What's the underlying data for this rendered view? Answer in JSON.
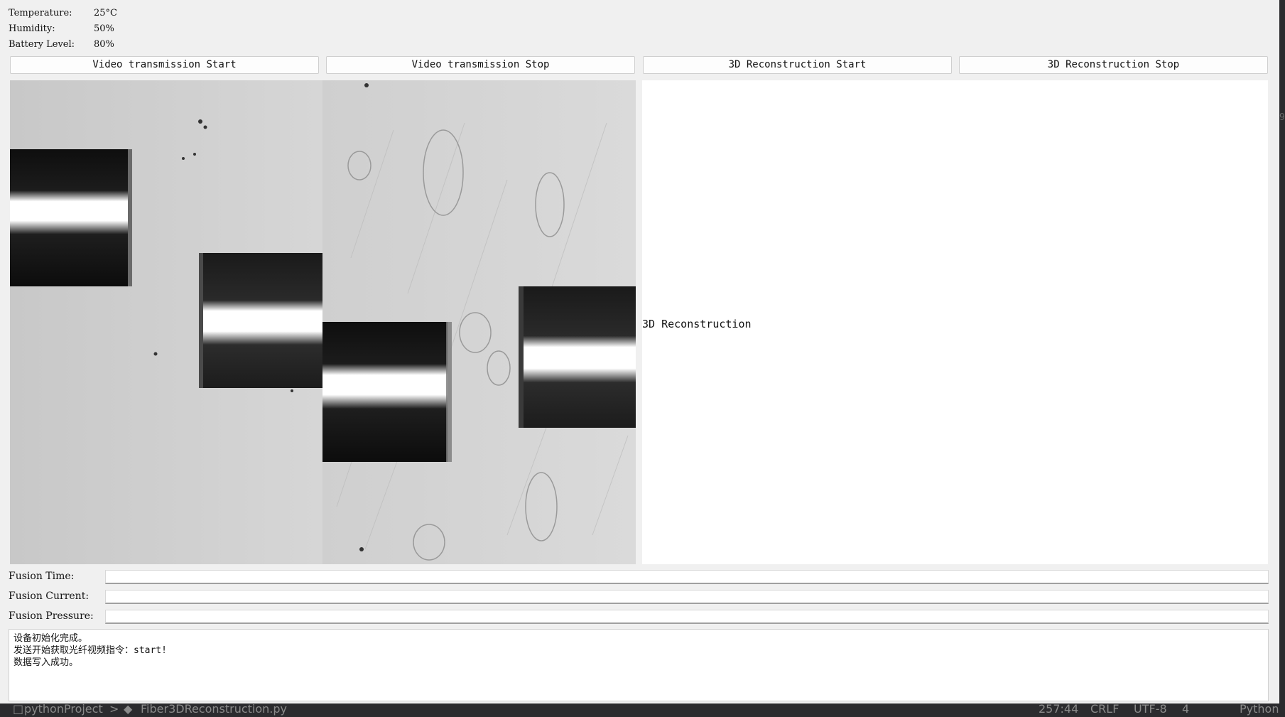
{
  "status": {
    "temperature_label": "Temperature:",
    "temperature_value": "25°C",
    "humidity_label": "Humidity:",
    "humidity_value": "50%",
    "battery_label": "Battery Level:",
    "battery_value": "80%"
  },
  "buttons": {
    "video_start": "Video transmission Start",
    "video_stop": "Video transmission Stop",
    "recon_start": "3D Reconstruction Start",
    "recon_stop": "3D Reconstruction Stop"
  },
  "reconstruction": {
    "label": "3D Reconstruction"
  },
  "fusion": {
    "time_label": "Fusion Time:",
    "current_label": "Fusion Current:",
    "pressure_label": "Fusion Pressure:"
  },
  "log": [
    "设备初始化完成。",
    "发送开始获取光纤视频指令：start!",
    "数据写入成功。"
  ],
  "ide_statusbar": {
    "project": "pythonProject",
    "separator": ">",
    "file": "Fiber3DReconstruction.py",
    "position": "257:44",
    "line_ending": "CRLF",
    "encoding": "UTF-8",
    "indent": "4",
    "lang_partial": "Python"
  },
  "colors": {
    "window_bg": "#f0f0f0",
    "panel_bg": "#ffffff",
    "ide_bg": "#2b2b2e"
  }
}
